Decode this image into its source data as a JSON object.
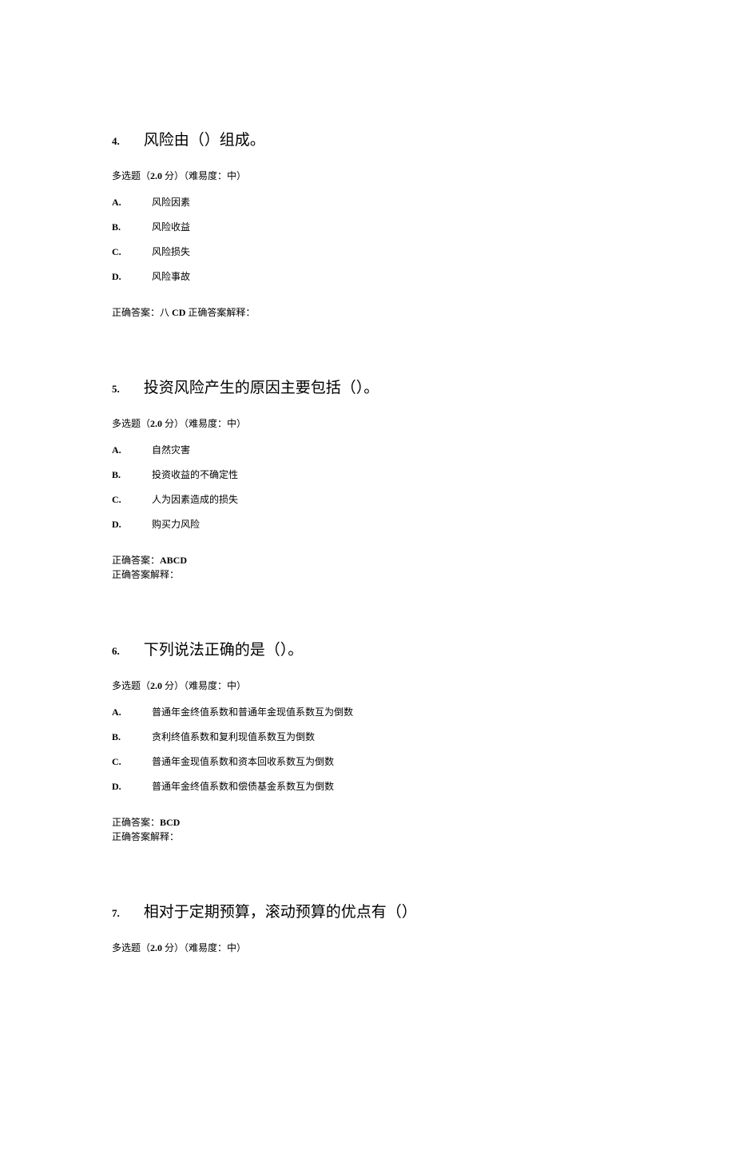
{
  "questions": [
    {
      "number": "4.",
      "title": "风险由（）组成。",
      "meta_prefix": "多选题（",
      "meta_score": "2.0",
      "meta_score_suffix": " 分）",
      "meta_difficulty": "（难易度：中）",
      "options": [
        {
          "letter": "A.",
          "text": "风险因素"
        },
        {
          "letter": "B.",
          "text": "风险收益"
        },
        {
          "letter": "C.",
          "text": "风险损失"
        },
        {
          "letter": "D.",
          "text": "风险事故"
        }
      ],
      "answer_label": "正确答案：",
      "answer_value_prefix": "八 ",
      "answer_value": "CD",
      "answer_explain_label": " 正确答案解释：",
      "answer_inline": true
    },
    {
      "number": "5.",
      "title": "投资风险产生的原因主要包括（）。",
      "meta_prefix": "多选题（",
      "meta_score": "2.0",
      "meta_score_suffix": " 分）",
      "meta_difficulty": "（难易度：中）",
      "options": [
        {
          "letter": "A.",
          "text": "自然灾害"
        },
        {
          "letter": "B.",
          "text": "投资收益的不确定性"
        },
        {
          "letter": "C.",
          "text": "人为因素造成的损失"
        },
        {
          "letter": "D.",
          "text": "购买力风险"
        }
      ],
      "answer_label": "正确答案：",
      "answer_value_prefix": "",
      "answer_value": "ABCD",
      "answer_explain_label": "正确答案解释：",
      "answer_inline": false
    },
    {
      "number": "6.",
      "title": "下列说法正确的是（）。",
      "meta_prefix": "多选题（",
      "meta_score": "2.0",
      "meta_score_suffix": " 分）",
      "meta_difficulty": "（难易度：中）",
      "options": [
        {
          "letter": "A.",
          "text": "普通年金终值系数和普通年金现值系数互为倒数"
        },
        {
          "letter": "B.",
          "text": "贪利终值系数和复利现值系数互为倒数"
        },
        {
          "letter": "C.",
          "text": "普通年金现值系数和资本回收系数互为倒数"
        },
        {
          "letter": "D.",
          "text": "普通年金终值系数和偿债基金系数互为倒数"
        }
      ],
      "answer_label": "正确答案：",
      "answer_value_prefix": "",
      "answer_value": "BCD",
      "answer_explain_label": "正确答案解释：",
      "answer_inline": false
    },
    {
      "number": "7.",
      "title": "相对于定期预算，滚动预算的优点有（）",
      "meta_prefix": "多选题（",
      "meta_score": "2.0",
      "meta_score_suffix": " 分）",
      "meta_difficulty": "（难易度：中）",
      "options": [],
      "answer_label": "",
      "answer_value_prefix": "",
      "answer_value": "",
      "answer_explain_label": "",
      "answer_inline": false
    }
  ]
}
